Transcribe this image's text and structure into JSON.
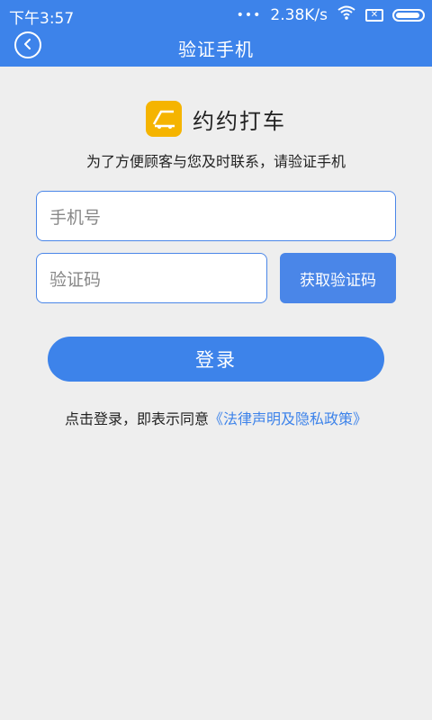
{
  "status": {
    "time": "下午3:57",
    "speed": "2.38K/s"
  },
  "header": {
    "title": "验证手机"
  },
  "brand": {
    "name": "约约打车"
  },
  "subtitle": "为了方便顾客与您及时联系，请验证手机",
  "form": {
    "phone_placeholder": "手机号",
    "code_placeholder": "验证码",
    "get_code_label": "获取验证码",
    "login_label": "登录"
  },
  "agreement": {
    "prefix": "点击登录，即表示同意",
    "link": "《法律声明及隐私政策》"
  },
  "colors": {
    "primary": "#3d83ea",
    "logo": "#f5b400"
  }
}
